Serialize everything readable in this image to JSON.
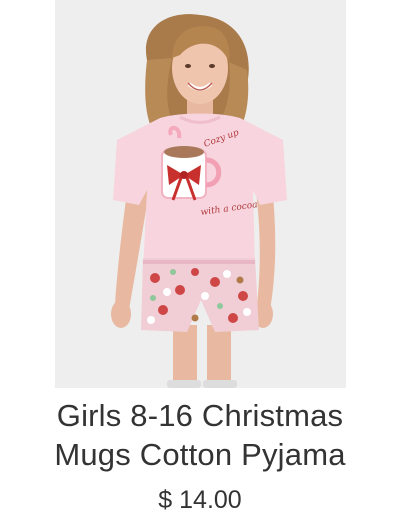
{
  "product": {
    "image_alt": "girl-wearing-pink-christmas-mugs-pyjama",
    "title_line1": "Girls 8-16 Christmas",
    "title_line2": "Mugs Cotton Pyjama",
    "price": "$ 14.00",
    "tee_print_line1": "Cozy up",
    "tee_print_line2": "with a cocoa"
  },
  "colors": {
    "background": "#eeeeee",
    "tee": "#f7d4de",
    "shorts": "#f1cdd6",
    "text": "#333333",
    "ribbon": "#c8302e"
  }
}
